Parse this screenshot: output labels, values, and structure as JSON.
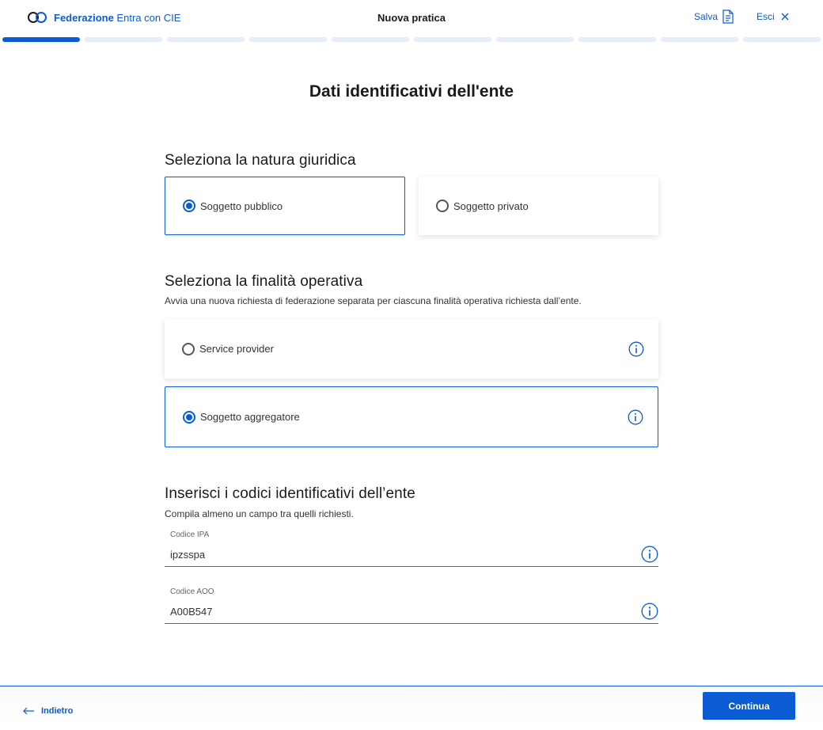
{
  "header": {
    "brand_bold": "Federazione",
    "brand_rest": "Entra con CIE",
    "title": "Nuova pratica",
    "save_label": "Salva",
    "exit_label": "Esci"
  },
  "progress": {
    "total_steps": 10,
    "current_step": 1
  },
  "page_title": "Dati identificativi dell'ente",
  "natura": {
    "title": "Seleziona la natura giuridica",
    "options": [
      {
        "label": "Soggetto pubblico",
        "selected": true
      },
      {
        "label": "Soggetto privato",
        "selected": false
      }
    ]
  },
  "finalita": {
    "title": "Seleziona la finalità operativa",
    "subtitle": "Avvia una nuova richiesta di federazione separata per ciascuna finalità operativa richiesta dall’ente.",
    "options": [
      {
        "label": "Service provider",
        "selected": false
      },
      {
        "label": "Soggetto aggregatore",
        "selected": true
      }
    ]
  },
  "codici": {
    "title": "Inserisci i codici identificativi dell’ente",
    "subtitle": "Compila almeno un campo tra quelli richiesti.",
    "fields": [
      {
        "label": "Codice IPA",
        "value": "ipzsspa"
      },
      {
        "label": "Codice AOO",
        "value": "A00B547"
      }
    ]
  },
  "footer": {
    "back_label": "Indietro",
    "continue_label": "Continua"
  },
  "colors": {
    "accent": "#0b5bd3",
    "track": "#e8eef7"
  }
}
